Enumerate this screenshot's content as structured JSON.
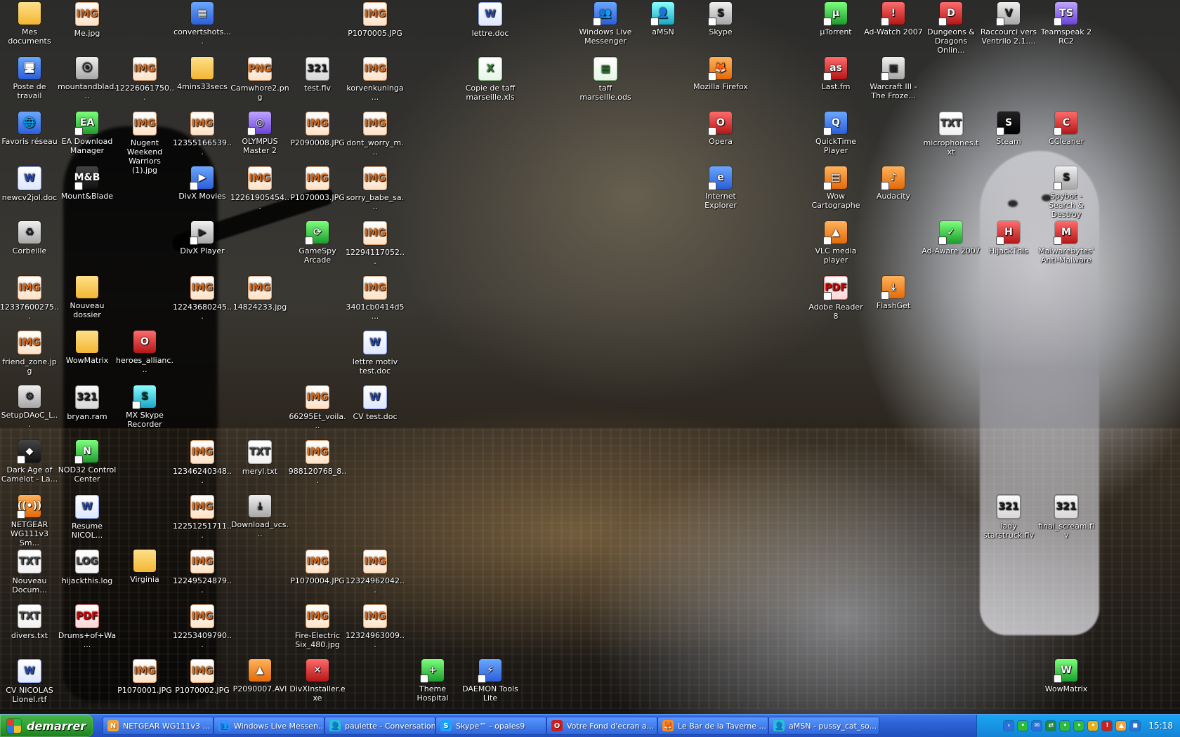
{
  "desktop": {
    "icons": [
      {
        "label": "Mes documents",
        "kind": "folder",
        "glyph": "",
        "shortcut": false,
        "icon": "documents-folder-icon"
      },
      {
        "label": "Me.jpg",
        "kind": "img",
        "glyph": "IMG",
        "shortcut": false,
        "icon": "image-file-icon"
      },
      {
        "label": "convertshots....",
        "kind": "app",
        "glyph": "▦",
        "shortcut": false,
        "icon": "app-icon"
      },
      {
        "label": "P1070005.JPG",
        "kind": "img",
        "glyph": "IMG",
        "shortcut": false,
        "icon": "image-file-icon"
      },
      {
        "label": "lettre.doc",
        "kind": "doc",
        "glyph": "W",
        "shortcut": false,
        "icon": "word-document-icon"
      },
      {
        "label": "Windows Live Messenger",
        "kind": "app",
        "glyph": "👥",
        "shortcut": true,
        "icon": "messenger-icon"
      },
      {
        "label": "aMSN",
        "kind": "cyan",
        "glyph": "👤",
        "shortcut": true,
        "icon": "amsn-icon"
      },
      {
        "label": "Skype",
        "kind": "gray",
        "glyph": "S",
        "shortcut": true,
        "icon": "skype-icon"
      },
      {
        "label": "µTorrent",
        "kind": "green",
        "glyph": "µ",
        "shortcut": true,
        "icon": "utorrent-icon"
      },
      {
        "label": "Ad-Watch 2007",
        "kind": "red",
        "glyph": "!",
        "shortcut": true,
        "icon": "adwatch-icon"
      },
      {
        "label": "Dungeons & Dragons Onlin...",
        "kind": "red",
        "glyph": "D",
        "shortcut": true,
        "icon": "game-icon"
      },
      {
        "label": "Raccourci vers Ventrilo 2.1....",
        "kind": "gray",
        "glyph": "V",
        "shortcut": true,
        "icon": "ventrilo-icon"
      },
      {
        "label": "Teamspeak 2 RC2",
        "kind": "purple",
        "glyph": "TS",
        "shortcut": true,
        "icon": "teamspeak-icon"
      },
      {
        "label": "Poste de travail",
        "kind": "app",
        "glyph": "🖥",
        "shortcut": false,
        "icon": "computer-icon"
      },
      {
        "label": "mountandblad...",
        "kind": "gray",
        "glyph": "⦿",
        "shortcut": false,
        "icon": "installer-icon"
      },
      {
        "label": "12226061750...",
        "kind": "img",
        "glyph": "IMG",
        "shortcut": false,
        "icon": "image-file-icon"
      },
      {
        "label": "4mins33secs",
        "kind": "folder",
        "glyph": "",
        "shortcut": false,
        "icon": "folder-icon"
      },
      {
        "label": "Camwhore2.png",
        "kind": "img",
        "glyph": "PNG",
        "shortcut": false,
        "icon": "image-file-icon"
      },
      {
        "label": "test.flv",
        "kind": "media",
        "glyph": "321",
        "shortcut": false,
        "icon": "video-file-icon"
      },
      {
        "label": "korvenkuninga...",
        "kind": "img",
        "glyph": "IMG",
        "shortcut": false,
        "icon": "image-file-icon"
      },
      {
        "label": "Copie de taff marseille.xls",
        "kind": "sheet",
        "glyph": "X",
        "shortcut": false,
        "icon": "spreadsheet-icon"
      },
      {
        "label": "taff marseille.ods",
        "kind": "sheet",
        "glyph": "▦",
        "shortcut": false,
        "icon": "spreadsheet-icon"
      },
      {
        "label": "Mozilla Firefox",
        "kind": "orange",
        "glyph": "🦊",
        "shortcut": true,
        "icon": "firefox-icon"
      },
      {
        "label": "Last.fm",
        "kind": "red",
        "glyph": "as",
        "shortcut": true,
        "icon": "lastfm-icon"
      },
      {
        "label": "Warcraft III - The Froze...",
        "kind": "gray",
        "glyph": "▣",
        "shortcut": true,
        "icon": "warcraft-icon"
      },
      {
        "label": "Favoris réseau",
        "kind": "app",
        "glyph": "🌐",
        "shortcut": false,
        "icon": "network-icon"
      },
      {
        "label": "EA Download Manager",
        "kind": "green",
        "glyph": "EA",
        "shortcut": true,
        "icon": "ea-icon"
      },
      {
        "label": "Nugent Weekend Warriors (1).jpg",
        "kind": "img",
        "glyph": "IMG",
        "shortcut": false,
        "icon": "image-file-icon"
      },
      {
        "label": "12355166539...",
        "kind": "img",
        "glyph": "IMG",
        "shortcut": false,
        "icon": "image-file-icon"
      },
      {
        "label": "OLYMPUS Master 2",
        "kind": "purple",
        "glyph": "◎",
        "shortcut": true,
        "icon": "camera-app-icon"
      },
      {
        "label": "P2090008.JPG",
        "kind": "img",
        "glyph": "IMG",
        "shortcut": false,
        "icon": "image-file-icon"
      },
      {
        "label": "dont_worry_m...",
        "kind": "img",
        "glyph": "IMG",
        "shortcut": false,
        "icon": "image-file-icon"
      },
      {
        "label": "Opera",
        "kind": "red",
        "glyph": "O",
        "shortcut": true,
        "icon": "opera-icon"
      },
      {
        "label": "QuickTime Player",
        "kind": "app",
        "glyph": "Q",
        "shortcut": true,
        "icon": "quicktime-icon"
      },
      {
        "label": "microphones.txt",
        "kind": "txt",
        "glyph": "TXT",
        "shortcut": false,
        "icon": "text-file-icon"
      },
      {
        "label": "Steam",
        "kind": "steam",
        "glyph": "S",
        "shortcut": true,
        "icon": "steam-icon"
      },
      {
        "label": "CCleaner",
        "kind": "red",
        "glyph": "C",
        "shortcut": true,
        "icon": "ccleaner-icon"
      },
      {
        "label": "newcv2jol.doc",
        "kind": "doc",
        "glyph": "W",
        "shortcut": false,
        "icon": "word-document-icon"
      },
      {
        "label": "Mount&Blade",
        "kind": "black",
        "glyph": "M&B",
        "shortcut": true,
        "icon": "mountandblade-icon"
      },
      {
        "label": "DivX Movies",
        "kind": "app",
        "glyph": "▶",
        "shortcut": true,
        "icon": "divx-icon"
      },
      {
        "label": "12261905454...",
        "kind": "img",
        "glyph": "IMG",
        "shortcut": false,
        "icon": "image-file-icon"
      },
      {
        "label": "P1070003.JPG",
        "kind": "img",
        "glyph": "IMG",
        "shortcut": false,
        "icon": "image-file-icon"
      },
      {
        "label": "sorry_babe_sa...",
        "kind": "img",
        "glyph": "IMG",
        "shortcut": false,
        "icon": "image-file-icon"
      },
      {
        "label": "Internet Explorer",
        "kind": "app",
        "glyph": "e",
        "shortcut": true,
        "icon": "internet-explorer-icon"
      },
      {
        "label": "Wow Cartographe",
        "kind": "orange",
        "glyph": "▤",
        "shortcut": true,
        "icon": "wow-cartographer-icon"
      },
      {
        "label": "Audacity",
        "kind": "orange",
        "glyph": "♪",
        "shortcut": true,
        "icon": "audacity-icon"
      },
      {
        "label": "Spybot - Search & Destroy",
        "kind": "gray",
        "glyph": "S",
        "shortcut": true,
        "icon": "spybot-icon"
      },
      {
        "label": "Corbeille",
        "kind": "gray",
        "glyph": "♻",
        "shortcut": false,
        "icon": "recycle-bin-icon"
      },
      {
        "label": "DivX Player",
        "kind": "gray",
        "glyph": "▶",
        "shortcut": true,
        "icon": "divx-player-icon"
      },
      {
        "label": "GameSpy Arcade",
        "kind": "green",
        "glyph": "⟳",
        "shortcut": true,
        "icon": "gamespy-icon"
      },
      {
        "label": "12294117052...",
        "kind": "img",
        "glyph": "IMG",
        "shortcut": false,
        "icon": "image-file-icon"
      },
      {
        "label": "VLC media player",
        "kind": "orange",
        "glyph": "▲",
        "shortcut": true,
        "icon": "vlc-icon"
      },
      {
        "label": "Ad-Aware 2007",
        "kind": "green",
        "glyph": "✓",
        "shortcut": true,
        "icon": "adaware-icon"
      },
      {
        "label": "HijackThis",
        "kind": "red",
        "glyph": "H",
        "shortcut": true,
        "icon": "hijackthis-icon"
      },
      {
        "label": "Malwarebytes' Anti-Malware",
        "kind": "red",
        "glyph": "M",
        "shortcut": true,
        "icon": "malwarebytes-icon"
      },
      {
        "label": "12337600275...",
        "kind": "img",
        "glyph": "IMG",
        "shortcut": false,
        "icon": "image-file-icon"
      },
      {
        "label": "Nouveau dossier",
        "kind": "folder",
        "glyph": "",
        "shortcut": false,
        "icon": "folder-icon"
      },
      {
        "label": "12243680245...",
        "kind": "img",
        "glyph": "IMG",
        "shortcut": false,
        "icon": "image-file-icon"
      },
      {
        "label": "14824233.jpg",
        "kind": "img",
        "glyph": "IMG",
        "shortcut": false,
        "icon": "image-file-icon"
      },
      {
        "label": "3401cb0414d5...",
        "kind": "img",
        "glyph": "IMG",
        "shortcut": false,
        "icon": "image-file-icon"
      },
      {
        "label": "Adobe Reader 8",
        "kind": "pdf",
        "glyph": "PDF",
        "shortcut": true,
        "icon": "adobe-reader-icon"
      },
      {
        "label": "FlashGet",
        "kind": "orange",
        "glyph": "⤓",
        "shortcut": true,
        "icon": "flashget-icon"
      },
      {
        "label": "friend_zone.jpg",
        "kind": "img",
        "glyph": "IMG",
        "shortcut": false,
        "icon": "image-file-icon"
      },
      {
        "label": "WowMatrix",
        "kind": "folder",
        "glyph": "",
        "shortcut": false,
        "icon": "folder-icon"
      },
      {
        "label": "heroes_allianc...",
        "kind": "red",
        "glyph": "O",
        "shortcut": false,
        "icon": "opera-document-icon"
      },
      {
        "label": "lettre motiv test.doc",
        "kind": "doc",
        "glyph": "W",
        "shortcut": false,
        "icon": "word-document-icon"
      },
      {
        "label": "SetupDAoC_L...",
        "kind": "gray",
        "glyph": "⚙",
        "shortcut": false,
        "icon": "setup-icon"
      },
      {
        "label": "bryan.ram",
        "kind": "media",
        "glyph": "321",
        "shortcut": false,
        "icon": "media-file-icon"
      },
      {
        "label": "MX Skype Recorder",
        "kind": "cyan",
        "glyph": "S",
        "shortcut": true,
        "icon": "skype-recorder-icon"
      },
      {
        "label": "66295Et_voila...",
        "kind": "img",
        "glyph": "IMG",
        "shortcut": false,
        "icon": "image-file-icon"
      },
      {
        "label": "CV test.doc",
        "kind": "doc",
        "glyph": "W",
        "shortcut": false,
        "icon": "word-document-icon"
      },
      {
        "label": "Dark Age of Camelot - La...",
        "kind": "black",
        "glyph": "◆",
        "shortcut": true,
        "icon": "game-icon"
      },
      {
        "label": "NOD32 Control Center",
        "kind": "green",
        "glyph": "N",
        "shortcut": true,
        "icon": "nod32-icon"
      },
      {
        "label": "12346240348...",
        "kind": "img",
        "glyph": "IMG",
        "shortcut": false,
        "icon": "image-file-icon"
      },
      {
        "label": "meryl.txt",
        "kind": "txt",
        "glyph": "TXT",
        "shortcut": false,
        "icon": "text-file-icon"
      },
      {
        "label": "988120768_8...",
        "kind": "img",
        "glyph": "IMG",
        "shortcut": false,
        "icon": "image-file-icon"
      },
      {
        "label": "NETGEAR WG111v3 Sm...",
        "kind": "orange",
        "glyph": "((•))",
        "shortcut": true,
        "icon": "netgear-icon"
      },
      {
        "label": "Resume NICOL...",
        "kind": "doc",
        "glyph": "W",
        "shortcut": false,
        "icon": "word-document-icon"
      },
      {
        "label": "12251251711...",
        "kind": "img",
        "glyph": "IMG",
        "shortcut": false,
        "icon": "image-file-icon"
      },
      {
        "label": "Download_vcs...",
        "kind": "gray",
        "glyph": "⤓",
        "shortcut": false,
        "icon": "installer-icon"
      },
      {
        "label": "lady starstruck.flv",
        "kind": "media",
        "glyph": "321",
        "shortcut": false,
        "icon": "video-file-icon"
      },
      {
        "label": "final_scream.flv",
        "kind": "media",
        "glyph": "321",
        "shortcut": false,
        "icon": "video-file-icon"
      },
      {
        "label": "Nouveau Docum...",
        "kind": "txt",
        "glyph": "TXT",
        "shortcut": false,
        "icon": "text-file-icon"
      },
      {
        "label": "hijackthis.log",
        "kind": "txt",
        "glyph": "LOG",
        "shortcut": false,
        "icon": "text-file-icon"
      },
      {
        "label": "Virginia",
        "kind": "folder",
        "glyph": "",
        "shortcut": false,
        "icon": "folder-icon"
      },
      {
        "label": "12249524879...",
        "kind": "img",
        "glyph": "IMG",
        "shortcut": false,
        "icon": "image-file-icon"
      },
      {
        "label": "P1070004.JPG",
        "kind": "img",
        "glyph": "IMG",
        "shortcut": false,
        "icon": "image-file-icon"
      },
      {
        "label": "12324962042...",
        "kind": "img",
        "glyph": "IMG",
        "shortcut": false,
        "icon": "image-file-icon"
      },
      {
        "label": "divers.txt",
        "kind": "txt",
        "glyph": "TXT",
        "shortcut": false,
        "icon": "text-file-icon"
      },
      {
        "label": "Drums+of+Wa...",
        "kind": "pdf",
        "glyph": "PDF",
        "shortcut": false,
        "icon": "pdf-file-icon"
      },
      {
        "label": "12253409790...",
        "kind": "img",
        "glyph": "IMG",
        "shortcut": false,
        "icon": "image-file-icon"
      },
      {
        "label": "Fire-Electric Six_480.jpg",
        "kind": "img",
        "glyph": "IMG",
        "shortcut": false,
        "icon": "image-file-icon"
      },
      {
        "label": "12324963009...",
        "kind": "img",
        "glyph": "IMG",
        "shortcut": false,
        "icon": "image-file-icon"
      },
      {
        "label": "CV NICOLAS Lionel.rtf",
        "kind": "doc",
        "glyph": "W",
        "shortcut": false,
        "icon": "word-document-icon"
      },
      {
        "label": "P1070001.JPG",
        "kind": "img",
        "glyph": "IMG",
        "shortcut": false,
        "icon": "image-file-icon"
      },
      {
        "label": "P1070002.JPG",
        "kind": "img",
        "glyph": "IMG",
        "shortcut": false,
        "icon": "image-file-icon"
      },
      {
        "label": "P2090007.AVI",
        "kind": "orange",
        "glyph": "▲",
        "shortcut": false,
        "icon": "video-file-icon"
      },
      {
        "label": "DivXInstaller.exe",
        "kind": "red",
        "glyph": "✕",
        "shortcut": false,
        "icon": "installer-icon"
      },
      {
        "label": "Theme Hospital",
        "kind": "green",
        "glyph": "+",
        "shortcut": true,
        "icon": "theme-hospital-icon"
      },
      {
        "label": "DAEMON Tools Lite",
        "kind": "app",
        "glyph": "⚡",
        "shortcut": true,
        "icon": "daemon-tools-icon"
      },
      {
        "label": "WowMatrix",
        "kind": "green",
        "glyph": "W",
        "shortcut": true,
        "icon": "wowmatrix-icon"
      }
    ]
  },
  "taskbar": {
    "start_label": "demarrer",
    "tasks": [
      {
        "label": "NETGEAR WG111v3 ...",
        "icon": "netgear-icon",
        "color": "#f3a33a",
        "glyph": "N"
      },
      {
        "label": "Windows Live Messen...",
        "icon": "messenger-icon",
        "color": "#3b8fff",
        "glyph": "👥"
      },
      {
        "label": "paulette - Conversation",
        "icon": "amsn-icon",
        "color": "#25c1d8",
        "glyph": "👤"
      },
      {
        "label": "Skype™ - opales9",
        "icon": "skype-icon",
        "color": "#1aa3ff",
        "glyph": "S"
      },
      {
        "label": "Votre Fond d'ecran a...",
        "icon": "opera-icon",
        "color": "#cc1f1f",
        "glyph": "O"
      },
      {
        "label": "Le Bar de la Taverne ...",
        "icon": "firefox-icon",
        "color": "#ff8a1f",
        "glyph": "🦊"
      },
      {
        "label": "aMSN - pussy_cat_so...",
        "icon": "amsn-icon",
        "color": "#25c1d8",
        "glyph": "👤"
      }
    ],
    "tray": {
      "clock": "15:18",
      "icons": [
        {
          "icon": "tray-arrow-icon",
          "color": "#2a72d9",
          "glyph": "‹"
        },
        {
          "icon": "tray-user-icon",
          "color": "#2dbb3a",
          "glyph": "•"
        },
        {
          "icon": "tray-mail-icon",
          "color": "#2a72d9",
          "glyph": "✉"
        },
        {
          "icon": "tray-network-icon",
          "color": "#1c8a3a",
          "glyph": "⇄"
        },
        {
          "icon": "tray-green-icon",
          "color": "#2dbb3a",
          "glyph": "•"
        },
        {
          "icon": "tray-green2-icon",
          "color": "#2dbb3a",
          "glyph": "•"
        },
        {
          "icon": "tray-yellow-icon",
          "color": "#e8b11a",
          "glyph": "•"
        },
        {
          "icon": "tray-red-icon",
          "color": "#cc1f1f",
          "glyph": "!"
        },
        {
          "icon": "tray-orange-icon",
          "color": "#f3a33a",
          "glyph": "▲"
        },
        {
          "icon": "tray-blue-icon",
          "color": "#2a72d9",
          "glyph": "◼"
        }
      ]
    }
  }
}
